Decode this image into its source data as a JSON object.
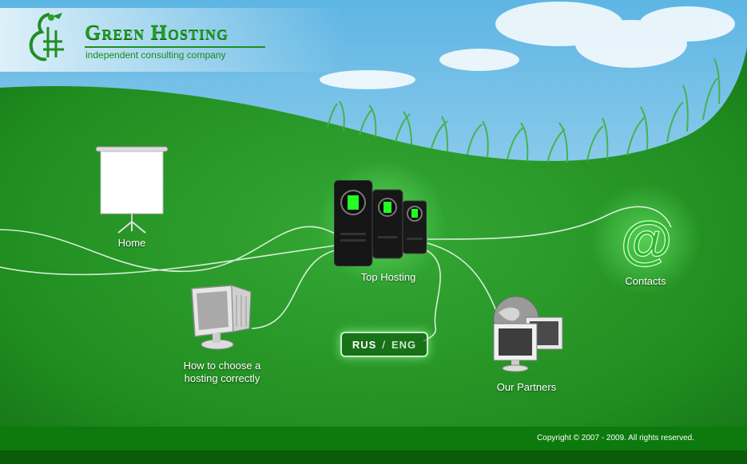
{
  "brand": {
    "name": "Green Hosting",
    "tagline": "independent consulting company"
  },
  "nav": {
    "home": "Home",
    "top_hosting": "Top Hosting",
    "contacts": "Contacts",
    "how_to_choose": "How to choose a hosting correctly",
    "partners": "Our Partners"
  },
  "lang": {
    "rus": "RUS",
    "separator": "/",
    "eng": "ENG"
  },
  "footer": {
    "copyright": "Copyright © 2007 - 2009. All rights reserved."
  },
  "icons": {
    "logo": "dragon-logo-icon",
    "home": "projector-screen-icon",
    "top_hosting": "server-towers-icon",
    "contacts": "at-sign-icon",
    "how_to_choose": "computer-monitor-icon",
    "partners": "globe-monitors-icon"
  },
  "colors": {
    "sky": "#bfe3f5",
    "grass": "#1f8a1f",
    "footer": "#0c7a0c",
    "brand": "#1f9d1f"
  }
}
